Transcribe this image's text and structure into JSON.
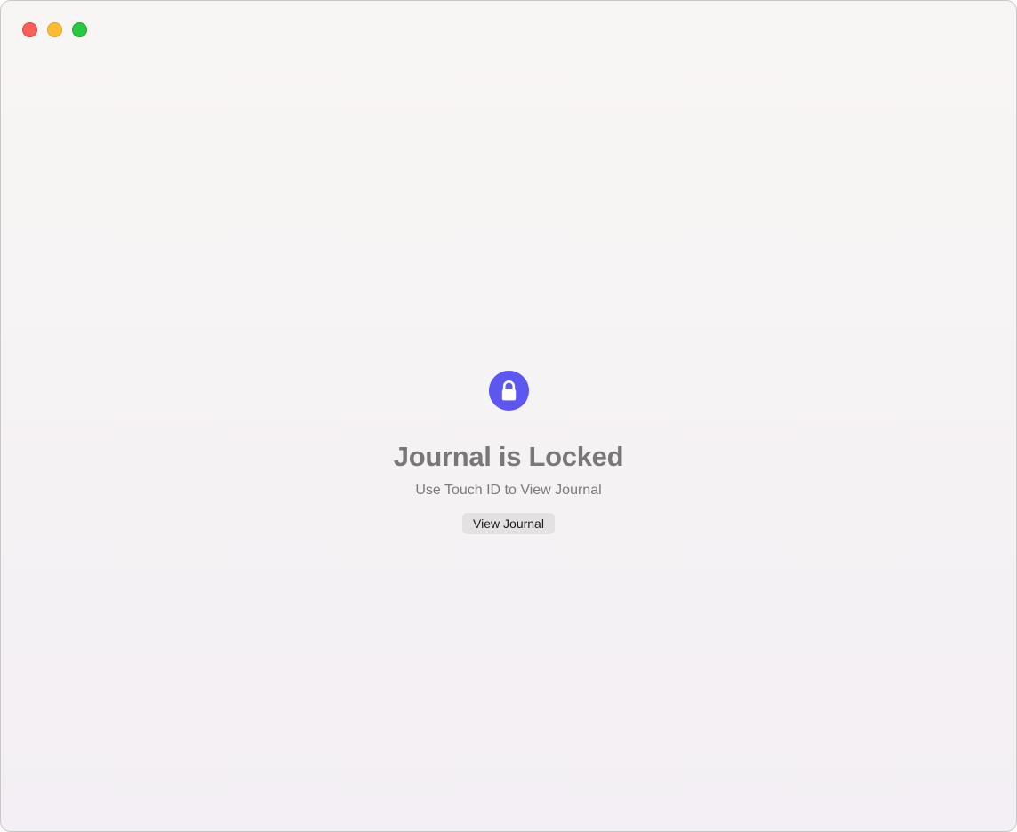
{
  "window": {
    "controls": {
      "close_color": "#fe5f57",
      "minimize_color": "#febc2e",
      "zoom_color": "#28c840"
    }
  },
  "lock_screen": {
    "icon": "lock-icon",
    "accent_color": "#5b57f0",
    "title": "Journal is Locked",
    "subtitle": "Use Touch ID to View Journal",
    "button_label": "View Journal"
  }
}
